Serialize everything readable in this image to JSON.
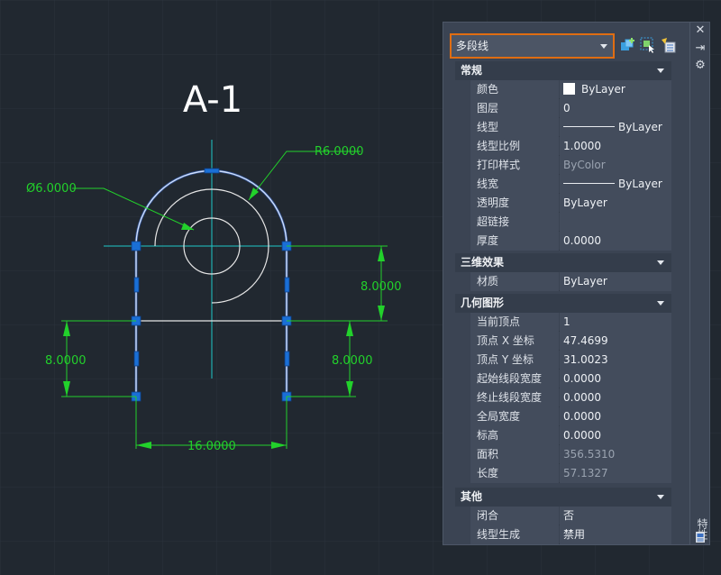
{
  "drawing": {
    "title": "A-1",
    "radius_dim": "R6.0000",
    "diameter_dim": "Ø6.0000",
    "dim_right_upper": "8.0000",
    "dim_left": "8.0000",
    "dim_right_lower": "8.0000",
    "dim_bottom": "16.0000",
    "colors": {
      "dimension": "#22d12b",
      "centerline": "#1fc8c8",
      "geometry": "#e6e6e6",
      "selected": "#7ea6ff",
      "grip": "#1a6fd6"
    }
  },
  "palette": {
    "selector": "多段线",
    "icons": [
      "toggle-pickadd-icon",
      "select-objects-icon",
      "quick-select-icon"
    ],
    "sections": [
      {
        "title": "常规",
        "rows": [
          {
            "name": "颜色",
            "value": "ByLayer",
            "swatch": true
          },
          {
            "name": "图层",
            "value": "0"
          },
          {
            "name": "线型",
            "value": "ByLayer",
            "linetype": true
          },
          {
            "name": "线型比例",
            "value": "1.0000"
          },
          {
            "name": "打印样式",
            "value": "ByColor",
            "dim": true
          },
          {
            "name": "线宽",
            "value": "ByLayer",
            "linetype": true
          },
          {
            "name": "透明度",
            "value": "ByLayer"
          },
          {
            "name": "超链接",
            "value": ""
          },
          {
            "name": "厚度",
            "value": "0.0000"
          }
        ]
      },
      {
        "title": "三维效果",
        "rows": [
          {
            "name": "材质",
            "value": "ByLayer"
          }
        ]
      },
      {
        "title": "几何图形",
        "rows": [
          {
            "name": "当前顶点",
            "value": "1"
          },
          {
            "name": "顶点 X 坐标",
            "value": "47.4699"
          },
          {
            "name": "顶点 Y 坐标",
            "value": "31.0023"
          },
          {
            "name": "起始线段宽度",
            "value": "0.0000"
          },
          {
            "name": "终止线段宽度",
            "value": "0.0000"
          },
          {
            "name": "全局宽度",
            "value": "0.0000"
          },
          {
            "name": "标高",
            "value": "0.0000"
          },
          {
            "name": "面积",
            "value": "356.5310",
            "dim": true
          },
          {
            "name": "长度",
            "value": "57.1327",
            "dim": true
          }
        ]
      },
      {
        "title": "其他",
        "rows": [
          {
            "name": "闭合",
            "value": "否"
          },
          {
            "name": "线型生成",
            "value": "禁用"
          }
        ]
      }
    ],
    "side_title": "特性",
    "side_icons": [
      "close-icon",
      "auto-hide-icon",
      "settings-icon",
      "properties-icon"
    ]
  }
}
